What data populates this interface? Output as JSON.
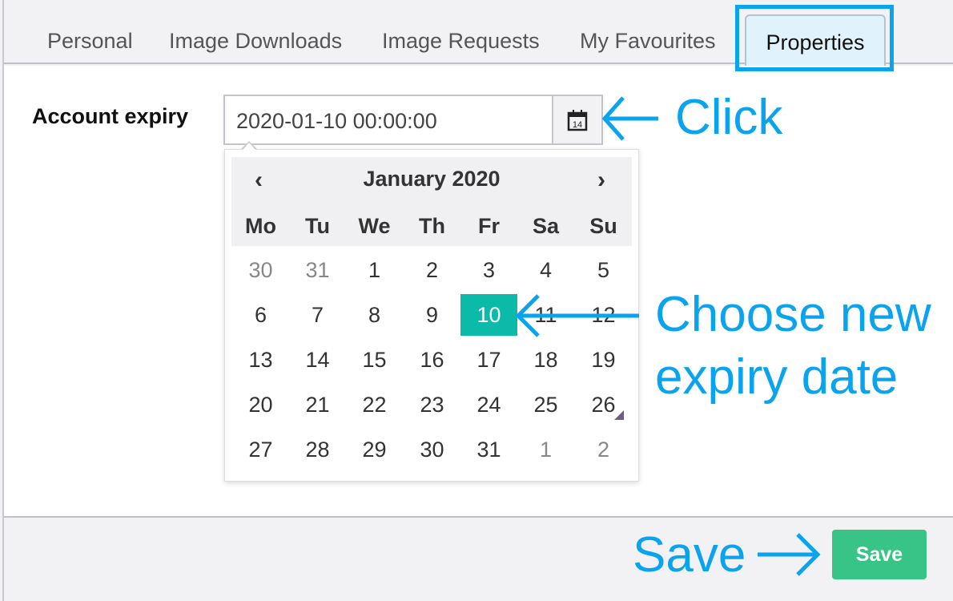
{
  "tabs": [
    {
      "label": "Personal"
    },
    {
      "label": "Image Downloads"
    },
    {
      "label": "Image Requests"
    },
    {
      "label": "My Favourites"
    },
    {
      "label": "Properties",
      "active": true
    }
  ],
  "form": {
    "label": "Account expiry",
    "value": "2020-01-10 00:00:00",
    "calendar_icon_day": "14"
  },
  "calendar": {
    "prev": "‹",
    "next": "›",
    "month": "January 2020",
    "weekdays": [
      "Mo",
      "Tu",
      "We",
      "Th",
      "Fr",
      "Sa",
      "Su"
    ],
    "weeks": [
      [
        "30",
        "31",
        "1",
        "2",
        "3",
        "4",
        "5"
      ],
      [
        "6",
        "7",
        "8",
        "9",
        "10",
        "11",
        "12"
      ],
      [
        "13",
        "14",
        "15",
        "16",
        "17",
        "18",
        "19"
      ],
      [
        "20",
        "21",
        "22",
        "23",
        "24",
        "25",
        "26"
      ],
      [
        "27",
        "28",
        "29",
        "30",
        "31",
        "1",
        "2"
      ]
    ],
    "selected": "10"
  },
  "annotations": {
    "click": "Click",
    "choose": "Choose new expiry date",
    "choose_l1": "Choose new",
    "choose_l2": "expiry date",
    "save": "Save"
  },
  "footer": {
    "save_label": "Save"
  },
  "colors": {
    "accent": "#0aa3ee",
    "selected": "#0bbaa8",
    "save": "#38c487"
  }
}
